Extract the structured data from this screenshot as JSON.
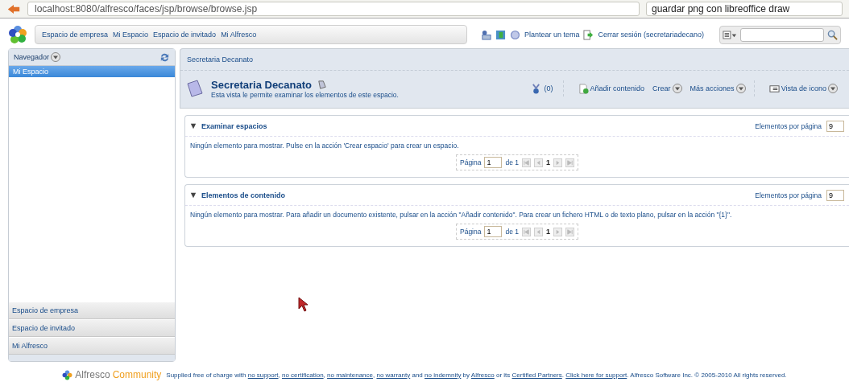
{
  "browser": {
    "url": "localhost:8080/alfresco/faces/jsp/browse/browse.jsp",
    "search": "guardar png con libreoffice draw"
  },
  "toolbar": {
    "links": [
      "Espacio de empresa",
      "Mi Espacio",
      "Espacio de invitado",
      "Mi Alfresco"
    ],
    "help_link": "Plantear un tema",
    "logout": "Cerrar sesión (secretariadecano)"
  },
  "navigator": {
    "title": "Navegador",
    "items": [
      {
        "label": "Mi Espacio",
        "selected": true
      }
    ],
    "shelves": [
      "Espacio de empresa",
      "Espacio de invitado",
      "Mi Alfresco"
    ]
  },
  "breadcrumb": "Secretaria Decanato",
  "space": {
    "title": "Secretaria Decanato",
    "description": "Esta vista le permite examinar los elementos de este espacio.",
    "count": "(0)",
    "actions": [
      {
        "label": "Añadir contenido",
        "kind": "add"
      },
      {
        "label": "Crear",
        "kind": "menu"
      },
      {
        "label": "Más acciones",
        "kind": "menu"
      },
      {
        "label": "Vista de icono",
        "kind": "view"
      }
    ]
  },
  "panels": [
    {
      "title": "Examinar espacios",
      "expanded": true,
      "per_page_label": "Elementos por página",
      "per_page": "9",
      "message": "Ningún elemento para mostrar. Pulse en la acción 'Crear espacio' para crear un espacio.",
      "page_label": "Página",
      "page": "1",
      "of": "de 1",
      "current": "1"
    },
    {
      "title": "Elementos de contenido",
      "expanded": true,
      "per_page_label": "Elementos por página",
      "per_page": "9",
      "message": "Ningún elemento para mostrar. Para añadir un documento existente, pulsar en la acción \"Añadir contenido\". Para crear un fichero HTML o de texto plano, pulsar en la acción \"{1}\".",
      "page_label": "Página",
      "page": "1",
      "of": "de 1",
      "current": "1"
    }
  ],
  "footer": {
    "brand_a": "Alfresco",
    "brand_b": "Community",
    "segments": [
      {
        "text": "Supplied free of charge with ",
        "link": false
      },
      {
        "text": "no support",
        "link": true
      },
      {
        "text": ", ",
        "link": false
      },
      {
        "text": "no certification",
        "link": true
      },
      {
        "text": ", ",
        "link": false
      },
      {
        "text": "no maintenance",
        "link": true
      },
      {
        "text": ", ",
        "link": false
      },
      {
        "text": "no warranty",
        "link": true
      },
      {
        "text": " and ",
        "link": false
      },
      {
        "text": "no indemnity",
        "link": true
      },
      {
        "text": " by ",
        "link": false
      },
      {
        "text": "Alfresco",
        "link": true
      },
      {
        "text": " or its ",
        "link": false
      },
      {
        "text": "Certified Partners",
        "link": true
      },
      {
        "text": ". ",
        "link": false
      },
      {
        "text": "Click here for support",
        "link": true
      },
      {
        "text": ". Alfresco Software Inc. © 2005-2010 All rights reserved.",
        "link": false
      }
    ]
  }
}
